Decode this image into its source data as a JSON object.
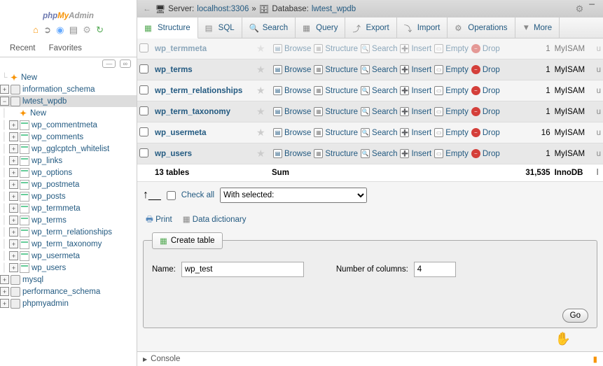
{
  "logo": {
    "php": "php",
    "my": "My",
    "admin": "Admin"
  },
  "recent": {
    "recent": "Recent",
    "favorites": "Favorites"
  },
  "tree": {
    "new": "New",
    "dbs": [
      {
        "name": "information_schema",
        "exp": "+"
      },
      {
        "name": "lwtest_wpdb",
        "exp": "−",
        "sel": true,
        "children": [
          {
            "name": "New",
            "new": true
          },
          {
            "name": "wp_commentmeta"
          },
          {
            "name": "wp_comments"
          },
          {
            "name": "wp_gglcptch_whitelist"
          },
          {
            "name": "wp_links"
          },
          {
            "name": "wp_options"
          },
          {
            "name": "wp_postmeta"
          },
          {
            "name": "wp_posts"
          },
          {
            "name": "wp_termmeta"
          },
          {
            "name": "wp_terms"
          },
          {
            "name": "wp_term_relationships"
          },
          {
            "name": "wp_term_taxonomy"
          },
          {
            "name": "wp_usermeta"
          },
          {
            "name": "wp_users"
          }
        ]
      },
      {
        "name": "mysql",
        "exp": "+"
      },
      {
        "name": "performance_schema",
        "exp": "+"
      },
      {
        "name": "phpmyadmin",
        "exp": "+"
      }
    ]
  },
  "breadcrumb": {
    "server_label": "Server:",
    "server": "localhost:3306",
    "sep": "»",
    "db_label": "Database:",
    "db": "lwtest_wpdb"
  },
  "tabs": [
    {
      "label": "Structure",
      "active": true
    },
    {
      "label": "SQL"
    },
    {
      "label": "Search"
    },
    {
      "label": "Query"
    },
    {
      "label": "Export"
    },
    {
      "label": "Import"
    },
    {
      "label": "Operations"
    },
    {
      "label": "More",
      "more": true
    }
  ],
  "actions": {
    "browse": "Browse",
    "structure": "Structure",
    "search": "Search",
    "insert": "Insert",
    "empty": "Empty",
    "drop": "Drop"
  },
  "rows": [
    {
      "name": "wp_termmeta",
      "n": "1",
      "engine": "MyISAM",
      "cut": true
    },
    {
      "name": "wp_terms",
      "n": "1",
      "engine": "MyISAM"
    },
    {
      "name": "wp_term_relationships",
      "n": "1",
      "engine": "MyISAM"
    },
    {
      "name": "wp_term_taxonomy",
      "n": "1",
      "engine": "MyISAM"
    },
    {
      "name": "wp_usermeta",
      "n": "16",
      "engine": "MyISAM"
    },
    {
      "name": "wp_users",
      "n": "1",
      "engine": "MyISAM"
    }
  ],
  "summary": {
    "tables": "13 tables",
    "sum": "Sum",
    "total": "31,535",
    "engine": "InnoDB"
  },
  "checkall": {
    "label": "Check all",
    "select": "With selected:"
  },
  "links": {
    "print": "Print",
    "dict": "Data dictionary"
  },
  "create": {
    "legend": "Create table",
    "name_label": "Name:",
    "name_value": "wp_test",
    "cols_label": "Number of columns:",
    "cols_value": "4",
    "go": "Go"
  },
  "console": "Console"
}
